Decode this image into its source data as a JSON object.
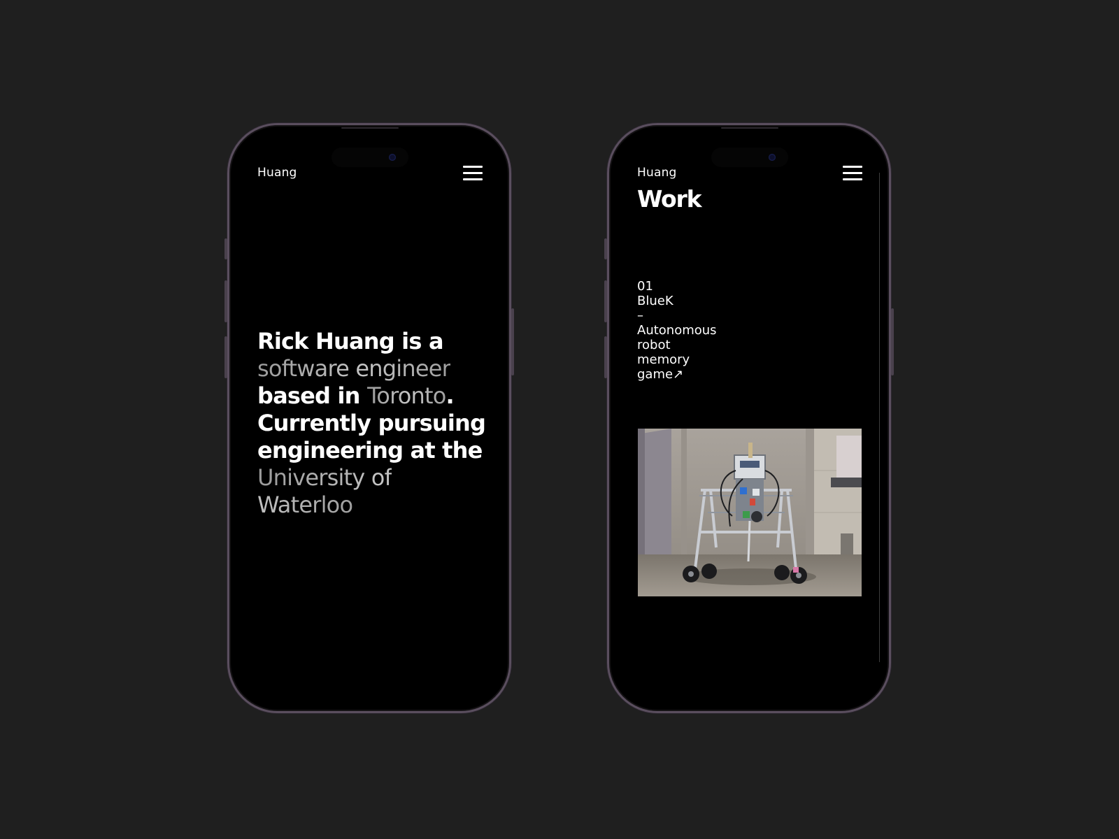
{
  "theme": {
    "page_background": "#1f1f1f",
    "phone_background": "#000000",
    "phone_frame": "#5a4e5e",
    "text_primary": "#ffffff",
    "text_muted": "#b3b3b3"
  },
  "screen_home": {
    "logo": "Huang",
    "menu_icon": "hamburger-menu-icon",
    "bio": {
      "part1": "Rick Huang is a ",
      "highlight_role": "software engineer",
      "part2": " based in ",
      "highlight_city": "Toronto",
      "part3": ". Currently pursuing engineering at the ",
      "highlight_school": "University of Waterloo"
    }
  },
  "screen_work": {
    "logo": "Huang",
    "menu_icon": "hamburger-menu-icon",
    "title": "Work",
    "item": {
      "number": "01",
      "name": "BlueK",
      "dash": "–",
      "description_lines": [
        "Autonomous",
        "robot",
        "memory"
      ],
      "last_word": "game",
      "arrow": "↗"
    },
    "image": "lego-robot-photo"
  }
}
